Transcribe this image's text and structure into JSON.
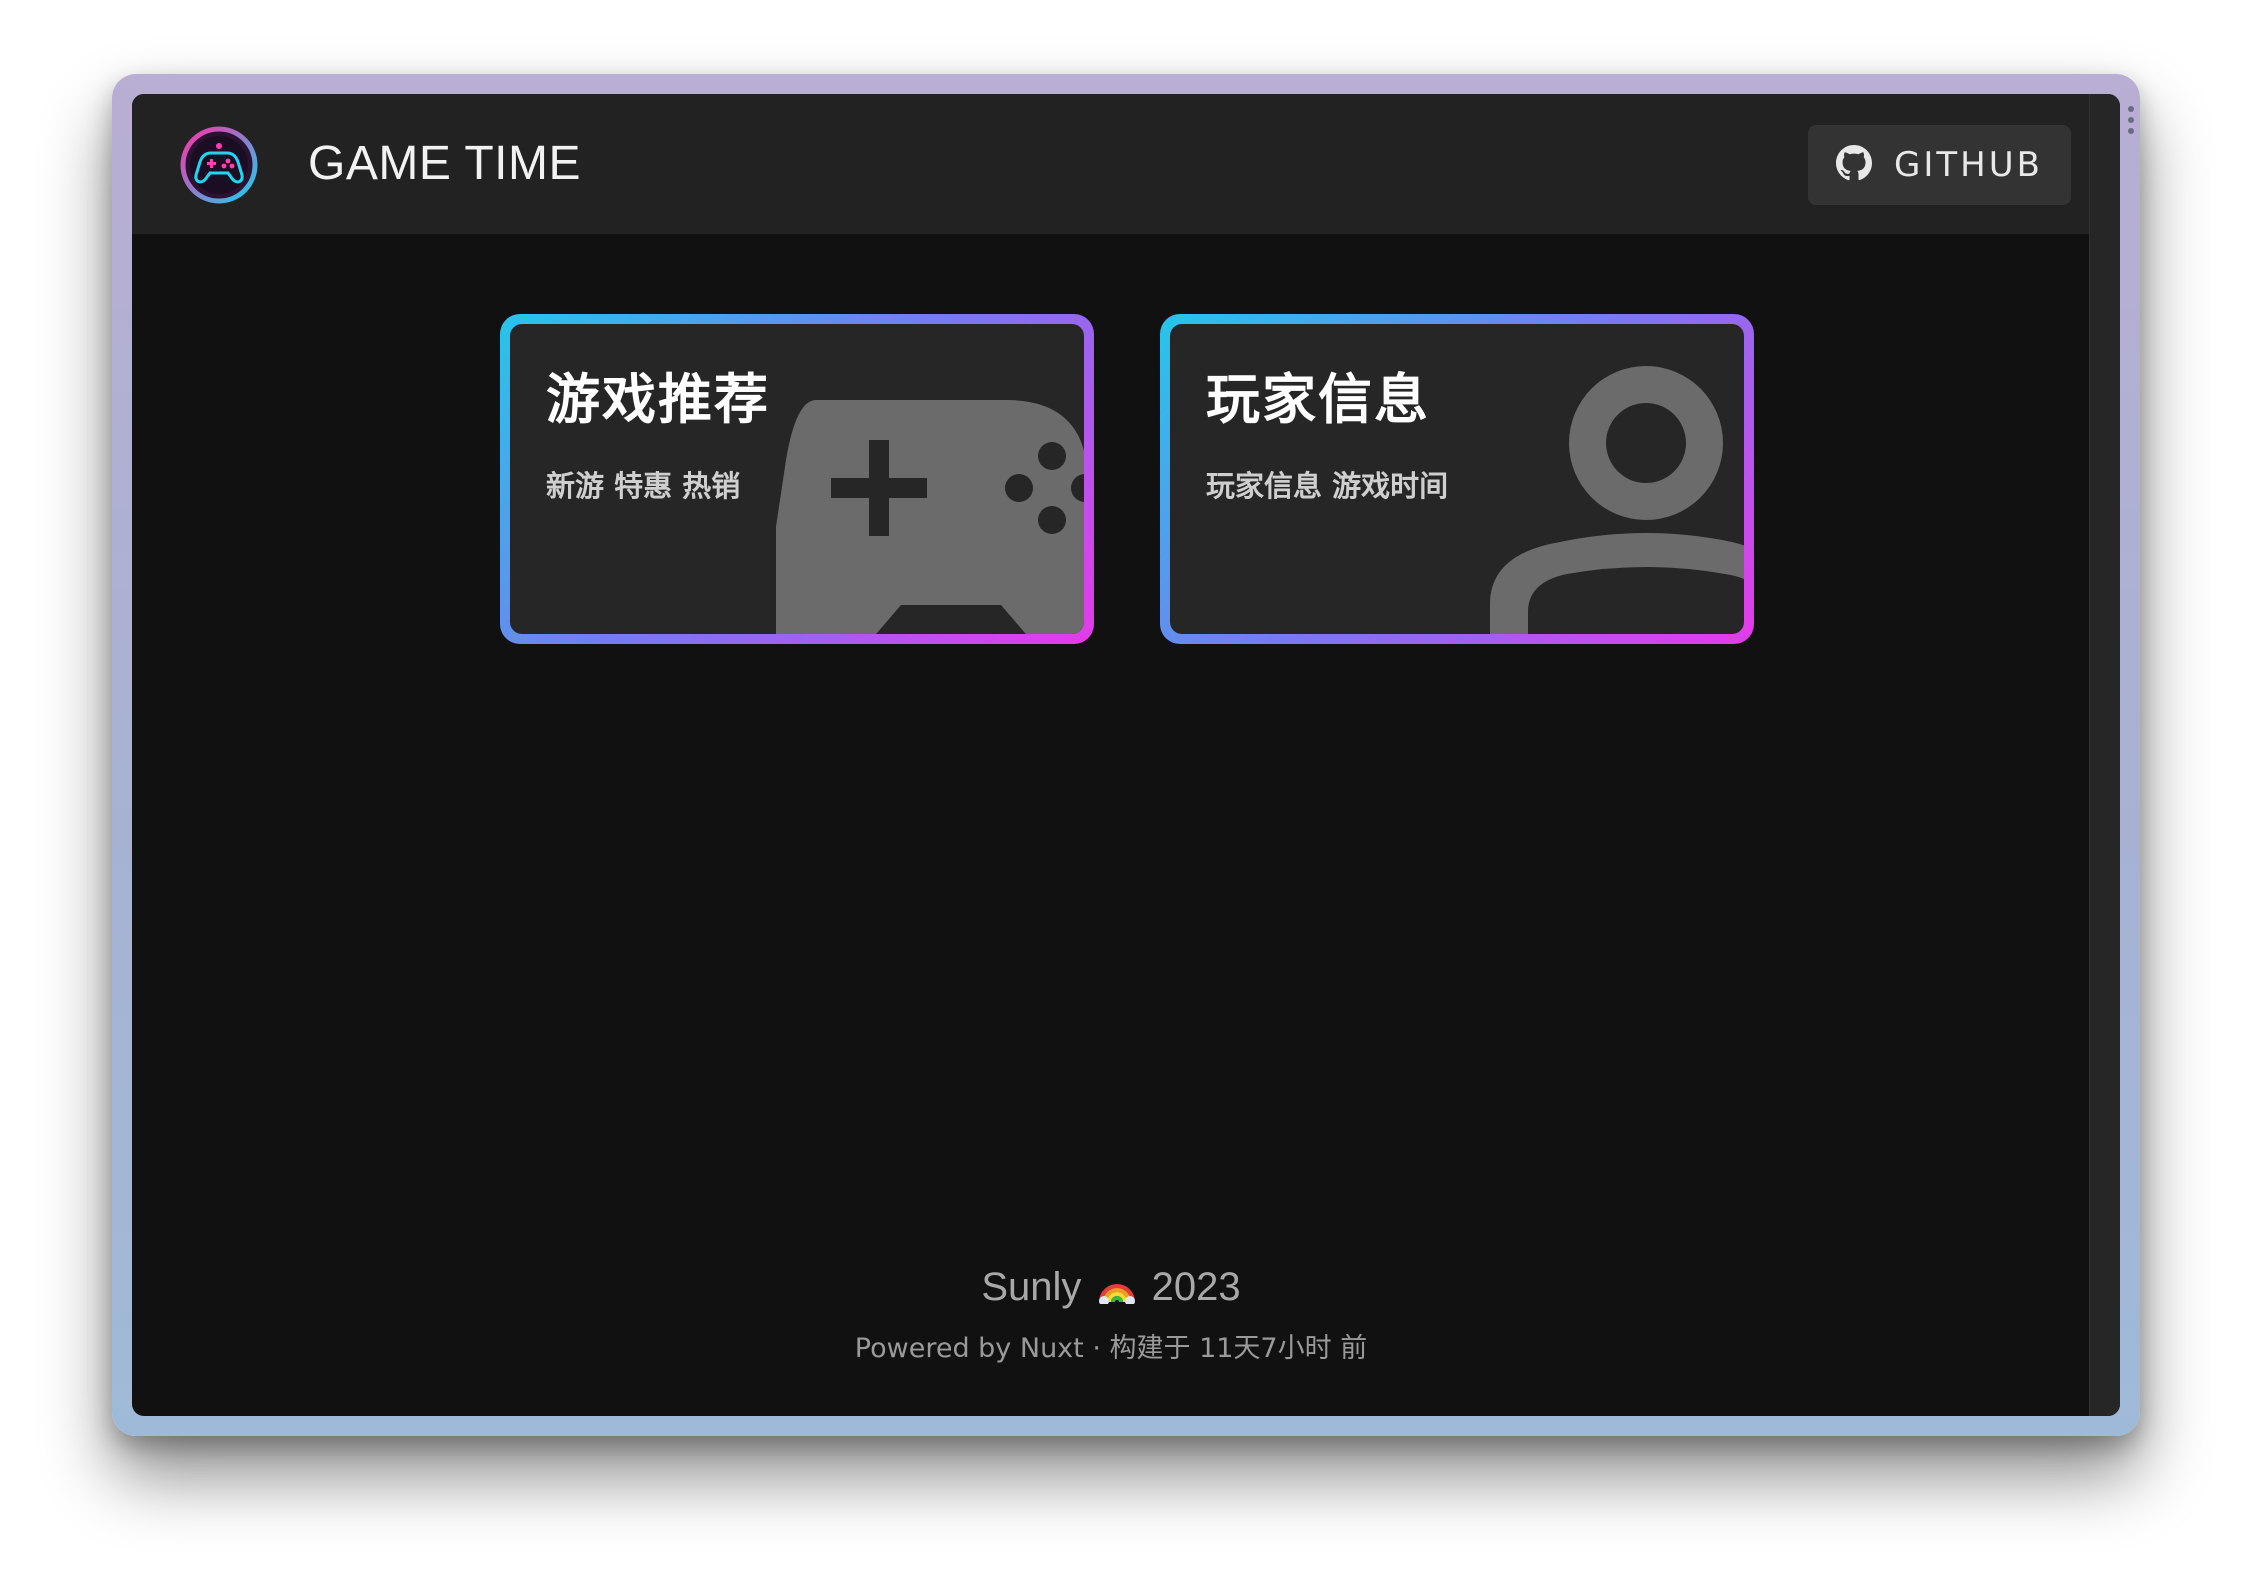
{
  "header": {
    "logo_icon": "gamepad-logo-icon",
    "title": "GAME TIME",
    "github": {
      "label": "GITHUB",
      "icon": "github-icon"
    }
  },
  "cards": [
    {
      "title": "游戏推荐",
      "subtitle": "新游 特惠 热销",
      "icon": "gamepad-icon"
    },
    {
      "title": "玩家信息",
      "subtitle": "玩家信息 游戏时间",
      "icon": "user-icon"
    }
  ],
  "footer": {
    "author": "Sunly",
    "emoji_icon": "rainbow-icon",
    "year": "2023",
    "powered": "Powered by Nuxt · 构建于 11天7小时 前"
  },
  "colors": {
    "page_bg": "#111111",
    "header_bg": "#222222",
    "card_bg": "#262626",
    "gradient_start": "#27c5ea",
    "gradient_mid": "#7a78f0",
    "gradient_end": "#e63ae9",
    "button_bg": "#333333"
  }
}
